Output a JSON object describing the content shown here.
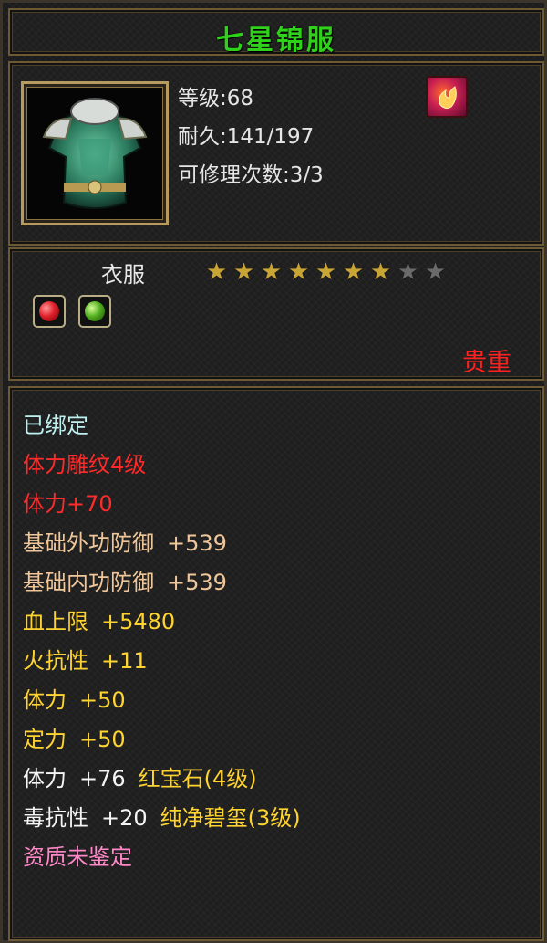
{
  "item": {
    "name": "七星锦服",
    "level": "等级:68",
    "durability": "耐久:141/197",
    "repair": "可修理次数:3/3",
    "type": "衣服",
    "rarity": "贵重",
    "stars_filled": 7,
    "stars_total": 9
  },
  "icons": {
    "item_icon": "armor-chestplate-icon",
    "skill_icon": "fire-emblem-icon",
    "gem1": "red-gem-icon",
    "gem2": "green-gem-icon"
  },
  "colors": {
    "title": "#2fd11a",
    "bound": "#bff0f0",
    "carving": "#ff2a2a",
    "base": "#f0c79b",
    "bonus": "#ffd430",
    "gem_label": "#f5f5f5",
    "gem_name": "#ffd430",
    "aptitude": "#ff88c8",
    "rarity": "#ff2020"
  },
  "attributes": [
    {
      "parts": [
        {
          "text": "已绑定",
          "color": "#bff0f0"
        }
      ]
    },
    {
      "parts": [
        {
          "text": "体力雕纹4级",
          "color": "#ff2a2a"
        }
      ]
    },
    {
      "parts": [
        {
          "text": "体力+70",
          "color": "#ff2a2a"
        }
      ]
    },
    {
      "parts": [
        {
          "text": "基础外功防御",
          "color": "#f0c79b"
        },
        {
          "text": "+539",
          "color": "#f0c79b"
        }
      ]
    },
    {
      "parts": [
        {
          "text": "基础内功防御",
          "color": "#f0c79b"
        },
        {
          "text": "+539",
          "color": "#f0c79b"
        }
      ]
    },
    {
      "parts": [
        {
          "text": "血上限",
          "color": "#ffd430"
        },
        {
          "text": "+5480",
          "color": "#ffd430"
        }
      ]
    },
    {
      "parts": [
        {
          "text": "火抗性",
          "color": "#ffd430"
        },
        {
          "text": "+11",
          "color": "#ffd430"
        }
      ]
    },
    {
      "parts": [
        {
          "text": "体力",
          "color": "#ffd430"
        },
        {
          "text": "+50",
          "color": "#ffd430"
        }
      ]
    },
    {
      "parts": [
        {
          "text": "定力",
          "color": "#ffd430"
        },
        {
          "text": "+50",
          "color": "#ffd430"
        }
      ]
    },
    {
      "parts": [
        {
          "text": "体力",
          "color": "#f5f5f5"
        },
        {
          "text": "+76",
          "color": "#f5f5f5"
        },
        {
          "text": "红宝石(4级)",
          "color": "#ffd430"
        }
      ]
    },
    {
      "parts": [
        {
          "text": "毒抗性",
          "color": "#f5f5f5"
        },
        {
          "text": "+20",
          "color": "#f5f5f5"
        },
        {
          "text": "纯净碧玺(3级)",
          "color": "#ffd430"
        }
      ]
    },
    {
      "parts": [
        {
          "text": "资质未鉴定",
          "color": "#ff88c8"
        }
      ]
    }
  ]
}
